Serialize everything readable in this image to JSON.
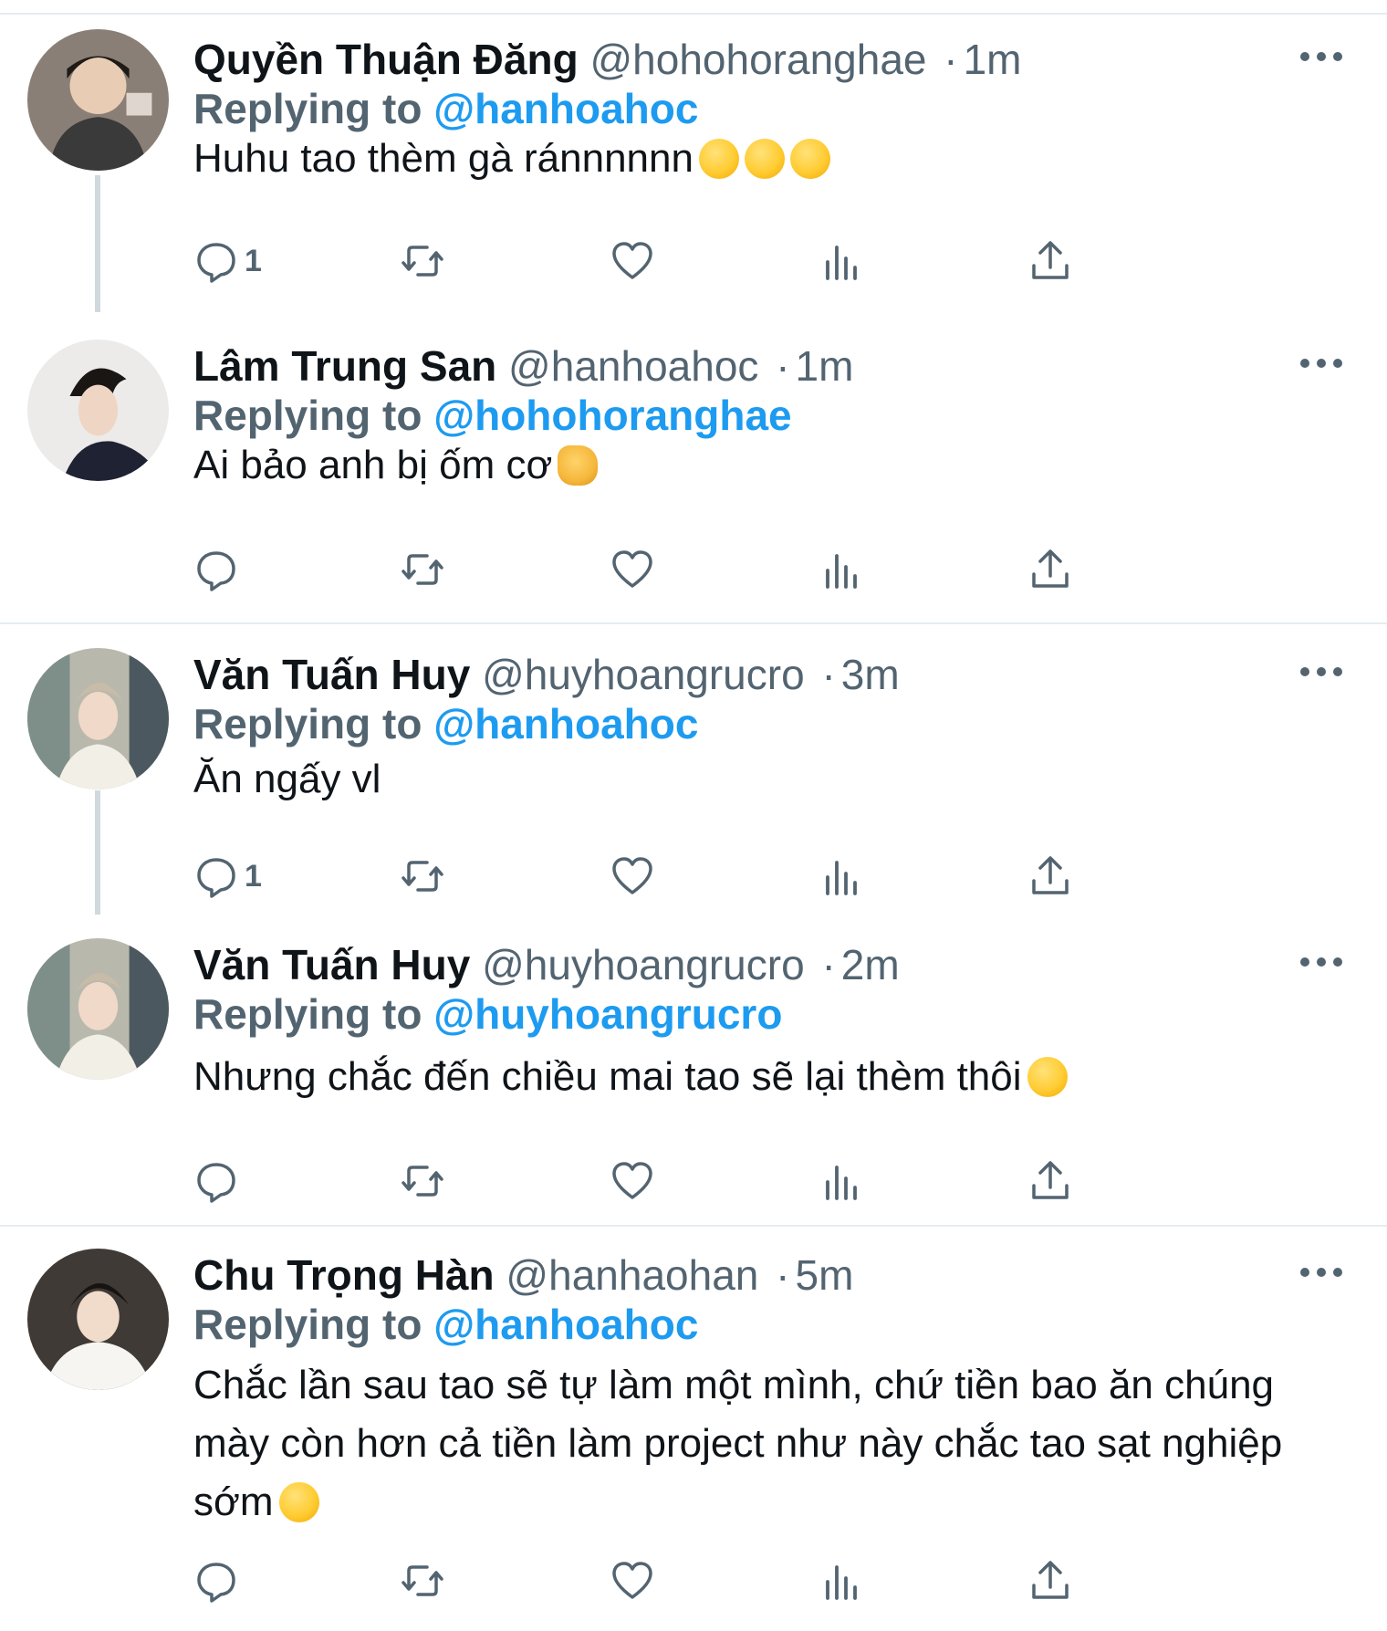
{
  "tweets": [
    {
      "name": "Quyền Thuận Đăng",
      "handle": "@hohohoranghae",
      "time": "1m",
      "replying_label": "Replying to",
      "replying_to": "@hanhoahoc",
      "text": "Huhu tao thèm gà ránnnnnn",
      "emojis": [
        "loudly-crying-face",
        "loudly-crying-face",
        "loudly-crying-face"
      ],
      "reply_count": "1"
    },
    {
      "name": "Lâm Trung San",
      "handle": "@hanhoahoc",
      "time": "1m",
      "replying_label": "Replying to",
      "replying_to": "@hohohoranghae",
      "text": "Ai bảo anh bị ốm cơ",
      "emojis": [
        "oncoming-fist"
      ],
      "reply_count": ""
    },
    {
      "name": "Văn Tuấn Huy",
      "handle": "@huyhoangrucro",
      "time": "3m",
      "replying_label": "Replying to",
      "replying_to": "@hanhoahoc",
      "text": "Ăn ngấy vl",
      "emojis": [],
      "reply_count": "1"
    },
    {
      "name": "Văn Tuấn Huy",
      "handle": "@huyhoangrucro",
      "time": "2m",
      "replying_label": "Replying to",
      "replying_to": "@huyhoangrucro",
      "text": "Nhưng chắc đến chiều mai tao sẽ lại thèm thôi",
      "emojis": [
        "face-savoring-food"
      ],
      "reply_count": ""
    },
    {
      "name": "Chu Trọng Hàn",
      "handle": "@hanhaohan",
      "time": "5m",
      "replying_label": "Replying to",
      "replying_to": "@hanhoahoc",
      "text": "Chắc lần sau tao sẽ tự làm một mình, chứ tiền bao ăn chúng mày còn hơn cả tiền làm project như này chắc tao sạt nghiệp sớm",
      "emojis": [
        "grinning-face-with-sweat"
      ],
      "reply_count": ""
    }
  ],
  "separator": "·",
  "icons": [
    "reply-icon",
    "retweet-icon",
    "like-icon",
    "analytics-icon",
    "share-icon",
    "more-icon"
  ],
  "colors": {
    "text": "#0f1419",
    "secondary": "#536471",
    "link": "#1d9bf0",
    "divider": "#e6ecf0",
    "thread_line": "#cfd9de"
  }
}
